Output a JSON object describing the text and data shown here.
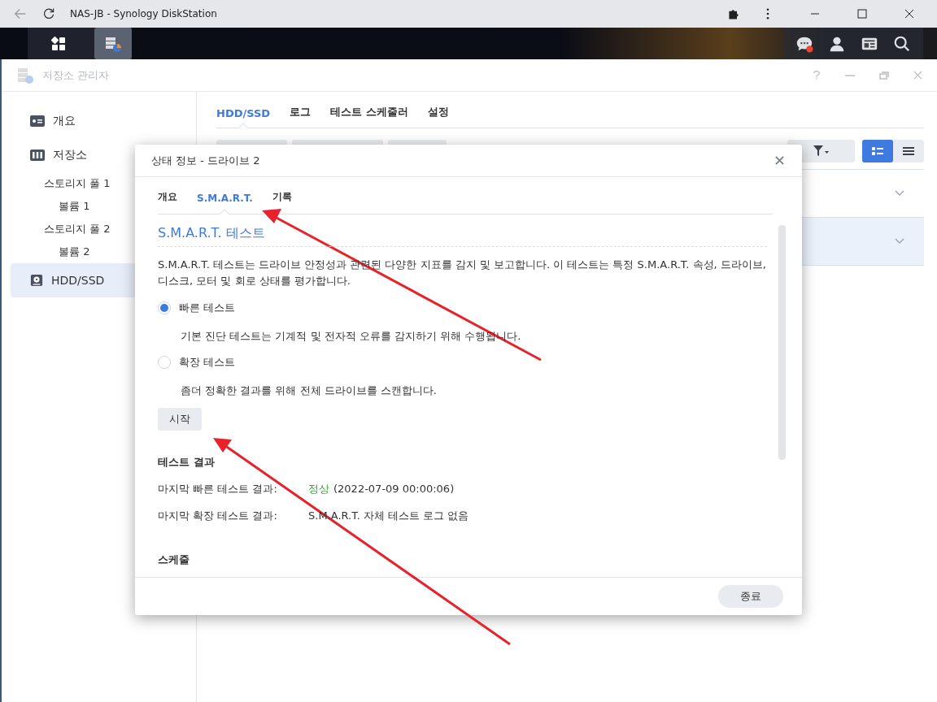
{
  "browser": {
    "title": "NAS-JB - Synology DiskStation"
  },
  "taskbar": {
    "apps": [
      {
        "selected": false
      },
      {
        "selected": true
      }
    ],
    "notification": true
  },
  "app_window": {
    "title": "저장소 관리자"
  },
  "sidebar": {
    "items": [
      {
        "label": "개요",
        "selected": false
      },
      {
        "label": "저장소",
        "selected": false,
        "children": [
          {
            "label": "스토리지 풀 1",
            "selected": false,
            "children": [
              {
                "label": "볼륨 1",
                "selected": false
              }
            ]
          },
          {
            "label": "스토리지 풀 2",
            "selected": false,
            "children": [
              {
                "label": "볼륨 2",
                "selected": false
              }
            ]
          }
        ]
      },
      {
        "label": "HDD/SSD",
        "selected": true
      }
    ]
  },
  "main": {
    "tabs": [
      {
        "label": "HDD/SSD",
        "selected": true
      },
      {
        "label": "로그",
        "selected": false
      },
      {
        "label": "테스트 스케줄러",
        "selected": false
      },
      {
        "label": "설정",
        "selected": false
      }
    ],
    "view_toggle": [
      {
        "selected": true
      },
      {
        "selected": false
      }
    ],
    "rows": [
      {
        "selected": false
      },
      {
        "selected": true
      }
    ]
  },
  "dialog": {
    "title": "상태 정보 - 드라이브 2",
    "tabs": [
      {
        "label": "개요",
        "selected": false
      },
      {
        "label": "S.M.A.R.T.",
        "selected": true
      },
      {
        "label": "기록",
        "selected": false
      }
    ],
    "section_title": "S.M.A.R.T. 테스트",
    "description": "S.M.A.R.T. 테스트는 드라이브 안정성과 관련된 다양한 지표를 감지 및 보고합니다. 이 테스트는 특정 S.M.A.R.T. 속성, 드라이브, 디스크, 모터 및 회로 상태를 평가합니다.",
    "options": [
      {
        "label": "빠른 테스트",
        "description": "기본 진단 테스트는 기계적 및 전자적 오류를 감지하기 위해 수행됩니다.",
        "selected": true
      },
      {
        "label": "확장 테스트",
        "description": "좀더 정확한 결과를 위해 전체 드라이브를 스캔합니다.",
        "selected": false
      }
    ],
    "start_button": "시작",
    "results_title": "테스트 결과",
    "results": [
      {
        "kind": "status",
        "label": "마지막 빠른 테스트 결과:",
        "status": "정상",
        "value": "(2022-07-09 00:00:06)"
      },
      {
        "kind": "text",
        "label": "마지막 확장 테스트 결과:",
        "value": "S.M.A.R.T. 자체 테스트 로그 없음"
      }
    ],
    "schedule_title": "스케줄",
    "close_button": "종료"
  }
}
